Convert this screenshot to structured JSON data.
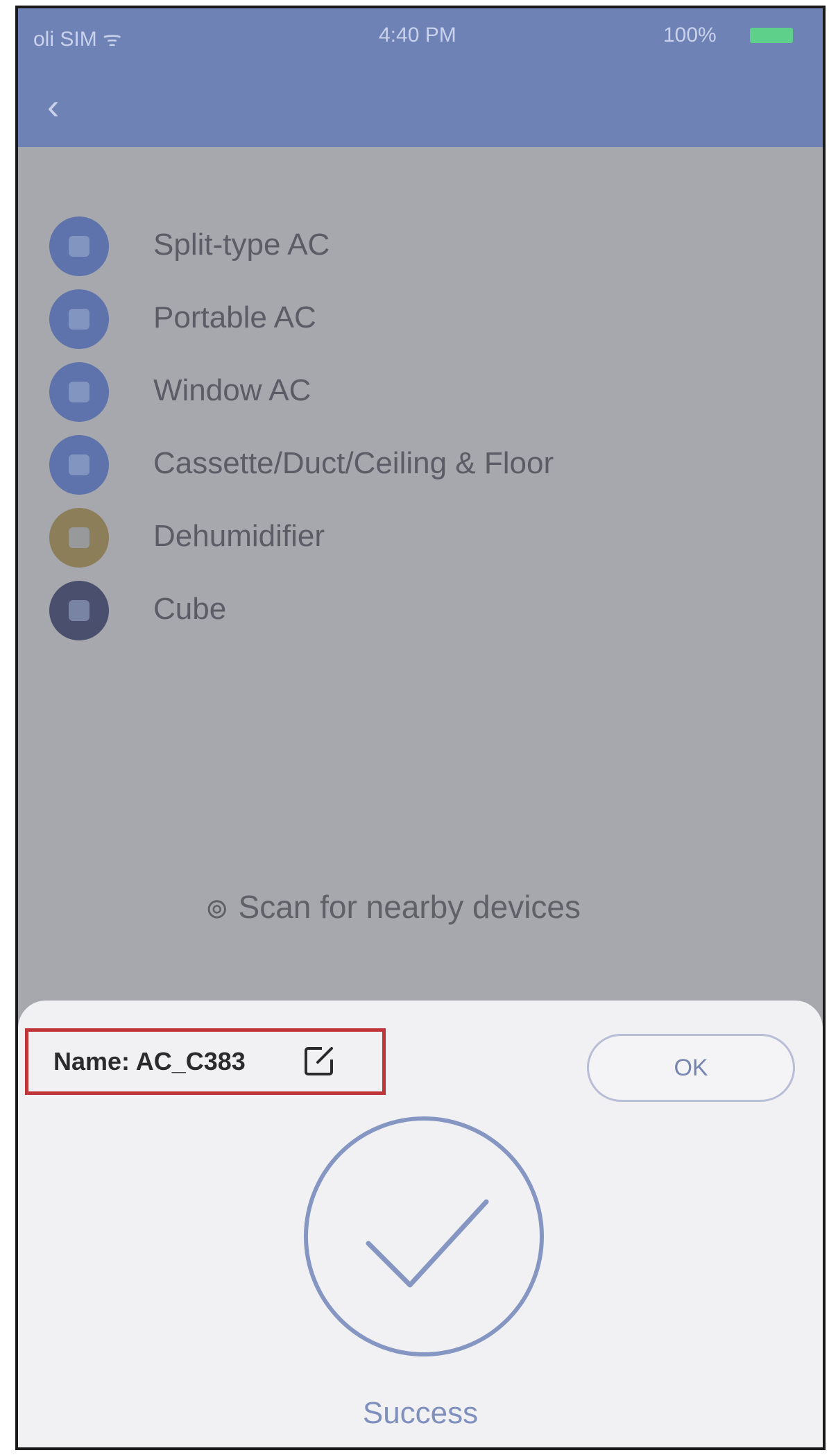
{
  "status_bar": {
    "carrier": "oli SIM ᯤ",
    "time": "4:40 PM",
    "battery_pct": "100%"
  },
  "nav": {
    "back_glyph": "‹",
    "title": ""
  },
  "device_types": [
    {
      "label": "Split-type AC",
      "icon": "split-ac-icon"
    },
    {
      "label": "Portable AC",
      "icon": "portable-ac-icon"
    },
    {
      "label": "Window AC",
      "icon": "window-ac-icon"
    },
    {
      "label": "Cassette/Duct/Ceiling & Floor",
      "icon": "cassette-ac-icon"
    },
    {
      "label": "Dehumidifier",
      "icon": "dehumidifier-icon"
    },
    {
      "label": "Cube",
      "icon": "cube-icon"
    }
  ],
  "scan": {
    "icon_glyph": "⊚",
    "label": "Scan for nearby devices"
  },
  "dialog": {
    "name_label": "Name: AC_C383",
    "ok_label": "OK",
    "success_label": "Success"
  },
  "colors": {
    "accent": "#6f82b6",
    "highlight_border": "#c0353a",
    "success": "#7f90bf"
  }
}
